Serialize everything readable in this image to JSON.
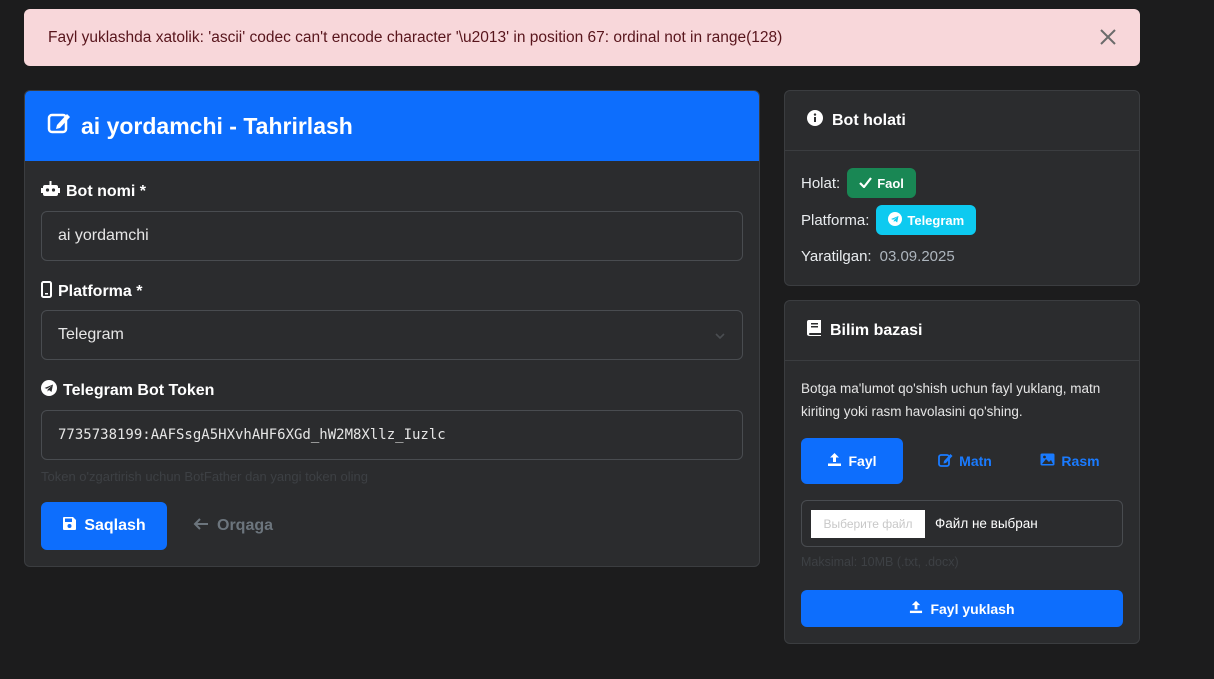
{
  "alert": {
    "message": "Fayl yuklashda xatolik: 'ascii' codec can't encode character '\\u2013' in position 67: ordinal not in range(128)"
  },
  "main": {
    "title": "ai yordamchi - Tahrirlash",
    "bot_name_label": "Bot nomi *",
    "bot_name_value": "ai yordamchi",
    "platform_label": "Platforma *",
    "platform_value": "Telegram",
    "token_label": "Telegram Bot Token",
    "token_value": "7735738199:AAFSsgA5HXvhAHF6XGd_hW2M8Xllz_Iuzlc",
    "token_help": "Token o'zgartirish uchun BotFather dan yangi token oling",
    "save_label": "Saqlash",
    "back_label": "Orqaga"
  },
  "status": {
    "title": "Bot holati",
    "state_label": "Holat:",
    "state_badge": "Faol",
    "platform_label": "Platforma:",
    "platform_badge": "Telegram",
    "created_label": "Yaratilgan:",
    "created_value": "03.09.2025"
  },
  "knowledge": {
    "title": "Bilim bazasi",
    "description": "Botga ma'lumot qo'shish uchun fayl yuklang, matn kiriting yoki rasm havolasini qo'shing.",
    "tabs": [
      {
        "label": "Fayl",
        "active": true
      },
      {
        "label": "Matn",
        "active": false
      },
      {
        "label": "Rasm",
        "active": false
      }
    ],
    "file_button": "Выберите файл",
    "file_status": "Файл не выбран",
    "file_help": "Maksimal: 10MB (.txt, .docx)",
    "upload_label": "Fayl yuklash"
  },
  "colors": {
    "primary": "#0d6efd",
    "success": "#198754",
    "info": "#0dcaf0",
    "alert_bg": "#f8d7da"
  }
}
